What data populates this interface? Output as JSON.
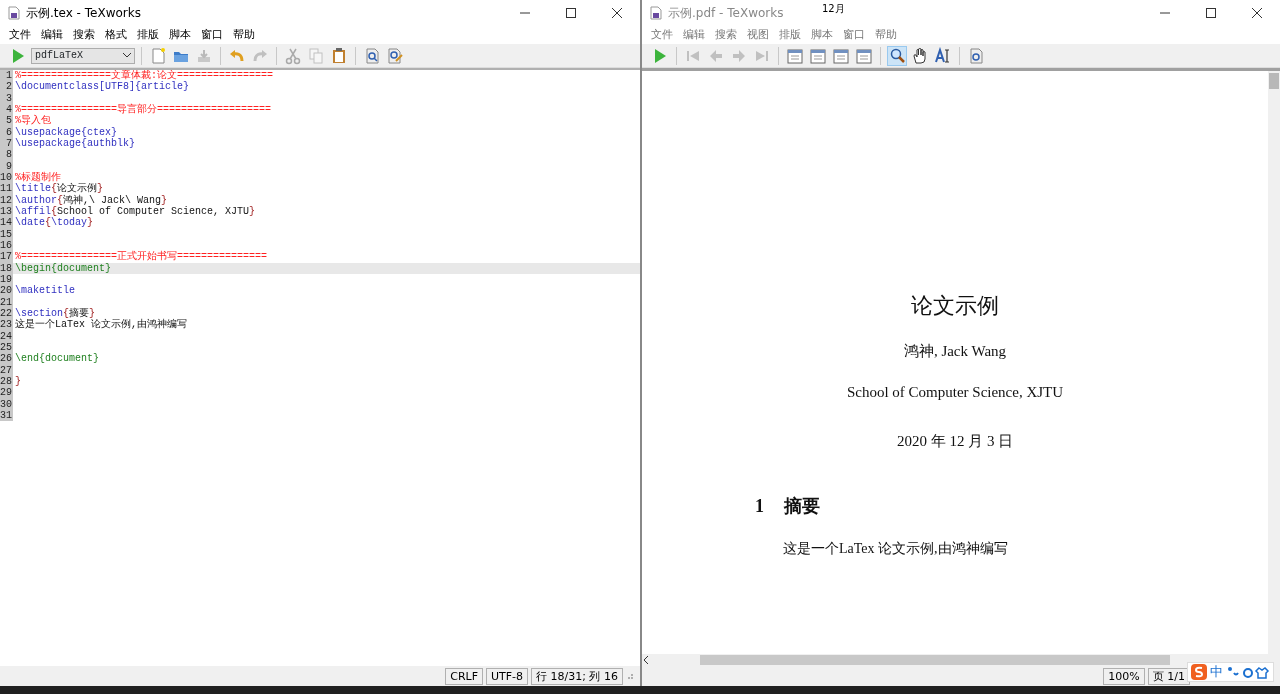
{
  "tooltip": "12月",
  "editor_window": {
    "title": "示例.tex - TeXworks",
    "menu": [
      "文件",
      "编辑",
      "搜索",
      "格式",
      "排版",
      "脚本",
      "窗口",
      "帮助"
    ],
    "toolbar": [
      {
        "kind": "button",
        "disabled": false
      },
      {
        "kind": "combo",
        "label": "pdfLaTeX"
      },
      {
        "kind": "separator"
      },
      {
        "kind": "button",
        "disabled": false
      },
      {
        "kind": "button",
        "disabled": false
      },
      {
        "kind": "button",
        "disabled": true
      },
      {
        "kind": "separator"
      },
      {
        "kind": "button",
        "disabled": false
      },
      {
        "kind": "button",
        "disabled": true
      },
      {
        "kind": "separator"
      },
      {
        "kind": "button",
        "disabled": true
      },
      {
        "kind": "button",
        "disabled": true
      },
      {
        "kind": "button",
        "disabled": false
      },
      {
        "kind": "separator"
      },
      {
        "kind": "button",
        "disabled": false
      },
      {
        "kind": "button",
        "disabled": false
      }
    ],
    "code_lines": [
      {
        "number": "1",
        "current": false,
        "segments": [
          {
            "kind": "comment",
            "text": "%===============文章体裁:论文================"
          }
        ]
      },
      {
        "number": "2",
        "current": false,
        "segments": [
          {
            "kind": "command",
            "text": "\\documentclass[UTF8]{article}"
          }
        ]
      },
      {
        "number": "3",
        "current": false
      },
      {
        "number": "4",
        "current": false,
        "segments": [
          {
            "kind": "comment",
            "text": "%================导言部分==================="
          }
        ]
      },
      {
        "number": "5",
        "current": false,
        "segments": [
          {
            "kind": "comment",
            "text": "%导入包"
          }
        ]
      },
      {
        "number": "6",
        "current": false,
        "segments": [
          {
            "kind": "command",
            "text": "\\usepackage{ctex}"
          }
        ]
      },
      {
        "number": "7",
        "current": false,
        "segments": [
          {
            "kind": "command",
            "text": "\\usepackage{authblk}"
          }
        ]
      },
      {
        "number": "8",
        "current": false
      },
      {
        "number": "9",
        "current": false
      },
      {
        "number": "10",
        "current": false,
        "segments": [
          {
            "kind": "comment",
            "text": "%标题制作"
          }
        ]
      },
      {
        "number": "11",
        "current": false,
        "segments": [
          {
            "kind": "command",
            "text": "\\title"
          },
          {
            "kind": "brace",
            "text": "{"
          },
          {
            "kind": "plain",
            "text": "论文示例"
          },
          {
            "kind": "brace",
            "text": "}"
          }
        ]
      },
      {
        "number": "12",
        "current": false,
        "segments": [
          {
            "kind": "command",
            "text": "\\author"
          },
          {
            "kind": "brace",
            "text": "{"
          },
          {
            "kind": "plain",
            "text": "鸿神,\\ Jack\\ Wang"
          },
          {
            "kind": "brace",
            "text": "}"
          }
        ]
      },
      {
        "number": "13",
        "current": false,
        "segments": [
          {
            "kind": "command",
            "text": "\\affil"
          },
          {
            "kind": "brace",
            "text": "{"
          },
          {
            "kind": "plain",
            "text": "School of Computer Science, XJTU"
          },
          {
            "kind": "brace",
            "text": "}"
          }
        ]
      },
      {
        "number": "14",
        "current": false,
        "segments": [
          {
            "kind": "command",
            "text": "\\date"
          },
          {
            "kind": "brace",
            "text": "{"
          },
          {
            "kind": "command",
            "text": "\\today"
          },
          {
            "kind": "brace",
            "text": "}"
          }
        ]
      },
      {
        "number": "15",
        "current": false
      },
      {
        "number": "16",
        "current": false
      },
      {
        "number": "17",
        "current": false,
        "segments": [
          {
            "kind": "comment",
            "text": "%================正式开始书写==============="
          }
        ]
      },
      {
        "number": "18",
        "current": true,
        "segments": [
          {
            "kind": "environment",
            "text": "\\begin{document}"
          }
        ]
      },
      {
        "number": "19",
        "current": false
      },
      {
        "number": "20",
        "current": false,
        "segments": [
          {
            "kind": "command",
            "text": "\\maketitle"
          }
        ]
      },
      {
        "number": "21",
        "current": false
      },
      {
        "number": "22",
        "current": false,
        "segments": [
          {
            "kind": "command",
            "text": "\\section"
          },
          {
            "kind": "brace",
            "text": "{"
          },
          {
            "kind": "plain",
            "text": "摘要"
          },
          {
            "kind": "brace",
            "text": "}"
          }
        ]
      },
      {
        "number": "23",
        "current": false,
        "segments": [
          {
            "kind": "plain",
            "text": "这是一个LaTex 论文示例,由鸿神编写"
          }
        ]
      },
      {
        "number": "24",
        "current": false
      },
      {
        "number": "25",
        "current": false
      },
      {
        "number": "26",
        "current": false,
        "segments": [
          {
            "kind": "environment",
            "text": "\\end{document}"
          }
        ]
      },
      {
        "number": "27",
        "current": false
      },
      {
        "number": "28",
        "current": false,
        "segments": [
          {
            "kind": "brace",
            "text": "}"
          }
        ]
      },
      {
        "number": "29",
        "current": false
      },
      {
        "number": "30",
        "current": false
      },
      {
        "number": "31",
        "current": false
      }
    ],
    "status_bar": [
      "CRLF",
      "UTF-8",
      "行 18/31; 列 16"
    ]
  },
  "pdf_window": {
    "title": "示例.pdf - TeXworks",
    "menu": [
      "文件",
      "编辑",
      "搜索",
      "视图",
      "排版",
      "脚本",
      "窗口",
      "帮助"
    ],
    "toolbar": [
      {
        "kind": "button",
        "disabled": false,
        "selected": false
      },
      {
        "kind": "separator"
      },
      {
        "kind": "button",
        "disabled": true,
        "selected": false
      },
      {
        "kind": "button",
        "disabled": true,
        "selected": false
      },
      {
        "kind": "button",
        "disabled": true,
        "selected": false
      },
      {
        "kind": "button",
        "disabled": true,
        "selected": false
      },
      {
        "kind": "separator"
      },
      {
        "kind": "button",
        "disabled": false,
        "selected": false
      },
      {
        "kind": "button",
        "disabled": false,
        "selected": false
      },
      {
        "kind": "button",
        "disabled": false,
        "selected": false
      },
      {
        "kind": "button",
        "disabled": false,
        "selected": false
      },
      {
        "kind": "separator"
      },
      {
        "kind": "button",
        "disabled": false,
        "selected": true
      },
      {
        "kind": "button",
        "disabled": false,
        "selected": false
      },
      {
        "kind": "button",
        "disabled": false,
        "selected": false
      },
      {
        "kind": "separator"
      },
      {
        "kind": "button",
        "disabled": false,
        "selected": false
      }
    ],
    "document": {
      "title": "论文示例",
      "author": "鸿神, Jack Wang",
      "affiliation": "School of Computer Science, XJTU",
      "date": "2020 年 12 月 3 日",
      "section_number": "1",
      "section_title": "摘要",
      "body": "这是一个LaTex 论文示例,由鸿神编写"
    },
    "status_bar": [
      "100%",
      "页 1/1"
    ]
  },
  "ime_bar": {
    "mode": "中"
  }
}
